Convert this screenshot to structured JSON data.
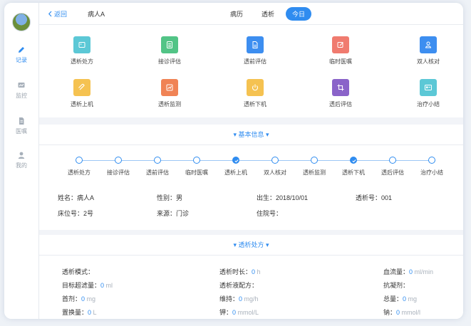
{
  "sidebar": {
    "items": [
      {
        "label": "记录",
        "icon": "pencil-icon",
        "active": true
      },
      {
        "label": "监控",
        "icon": "monitor-icon",
        "active": false
      },
      {
        "label": "医嘱",
        "icon": "document-icon",
        "active": false
      },
      {
        "label": "我的",
        "icon": "user-icon",
        "active": false
      }
    ]
  },
  "header": {
    "back_label": "返回",
    "patient_name": "病人A",
    "tabs": [
      {
        "label": "病历",
        "active": false
      },
      {
        "label": "透析",
        "active": false
      },
      {
        "label": "今日",
        "active": true
      }
    ]
  },
  "actions": [
    {
      "label": "透析处方",
      "icon": "prescription-icon",
      "color": "#5cc8d6"
    },
    {
      "label": "接诊评估",
      "icon": "checklist-icon",
      "color": "#52c486"
    },
    {
      "label": "透前评估",
      "icon": "file-icon",
      "color": "#3d8ef0"
    },
    {
      "label": "临时医嘱",
      "icon": "edit-icon",
      "color": "#f07b6f"
    },
    {
      "label": "双人核对",
      "icon": "users-icon",
      "color": "#3d8ef0"
    },
    {
      "label": "透析上机",
      "icon": "tag-icon",
      "color": "#f5c251"
    },
    {
      "label": "透析监测",
      "icon": "monitor-chart-icon",
      "color": "#f08355"
    },
    {
      "label": "透析下机",
      "icon": "power-icon",
      "color": "#f5c251"
    },
    {
      "label": "透后评估",
      "icon": "crop-icon",
      "color": "#8a63c9"
    },
    {
      "label": "治疗小结",
      "icon": "card-icon",
      "color": "#5cc8d6"
    }
  ],
  "basic": {
    "title": "基本信息",
    "steps": [
      {
        "label": "透析处方",
        "done": false
      },
      {
        "label": "接诊评估",
        "done": false
      },
      {
        "label": "透前评估",
        "done": false
      },
      {
        "label": "临时医嘱",
        "done": false
      },
      {
        "label": "透析上机",
        "done": true
      },
      {
        "label": "双人核对",
        "done": false
      },
      {
        "label": "透析监测",
        "done": false
      },
      {
        "label": "透析下机",
        "done": true
      },
      {
        "label": "透后评估",
        "done": false
      },
      {
        "label": "治疗小结",
        "done": false
      }
    ],
    "fields": [
      {
        "label": "姓名：",
        "value": "病人A"
      },
      {
        "label": "性别：",
        "value": "男"
      },
      {
        "label": "出生：",
        "value": "2018/10/01"
      },
      {
        "label": "透析号：",
        "value": "001"
      },
      {
        "label": "床位号：",
        "value": "2号"
      },
      {
        "label": "来源：",
        "value": "门诊"
      },
      {
        "label": "住院号：",
        "value": ""
      }
    ]
  },
  "prescription": {
    "title": "透析处方",
    "fields": [
      {
        "label": "透析模式：",
        "value": "",
        "unit": ""
      },
      {
        "label": "透析时长：",
        "value": "0",
        "unit": "h"
      },
      {
        "label": "血流量：",
        "value": "0",
        "unit": "ml/min"
      },
      {
        "label": "目标超滤量：",
        "value": "0",
        "unit": "ml"
      },
      {
        "label": "透析液配方：",
        "value": "",
        "unit": ""
      },
      {
        "label": "抗凝剂：",
        "value": "",
        "unit": ""
      },
      {
        "label": "首剂：",
        "value": "0",
        "unit": "mg"
      },
      {
        "label": "维持：",
        "value": "0",
        "unit": "mg/h"
      },
      {
        "label": "总量：",
        "value": "0",
        "unit": "mg"
      },
      {
        "label": "置换量：",
        "value": "0",
        "unit": "L"
      },
      {
        "label": "钾：",
        "value": "0",
        "unit": "mmol/L"
      },
      {
        "label": "钠：",
        "value": "0",
        "unit": "mmol/l"
      }
    ]
  }
}
